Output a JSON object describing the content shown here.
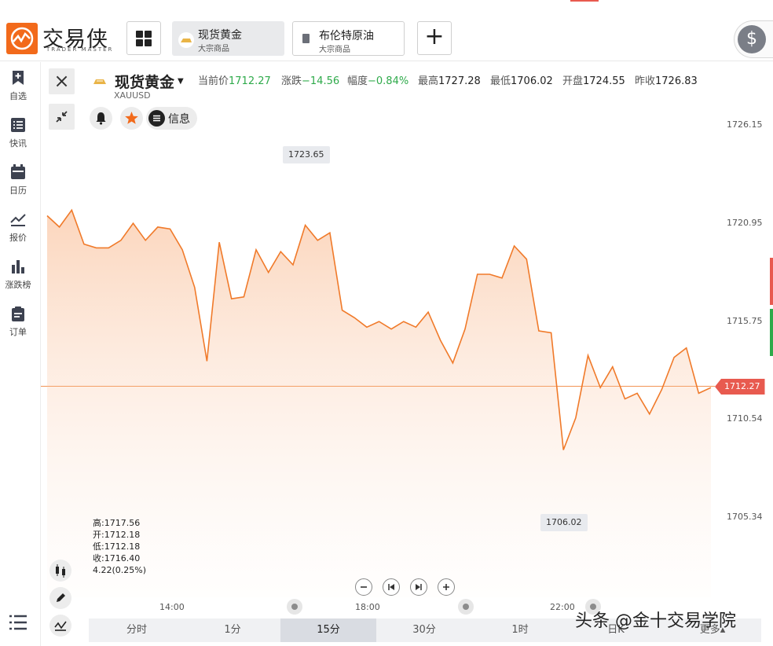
{
  "app": {
    "logo_title": "交易侠",
    "logo_subtitle": "TRADER MASTER"
  },
  "tabs": [
    {
      "name": "现货黄金",
      "sub": "大宗商品",
      "active": true
    },
    {
      "name": "布伦特原油",
      "sub": "大宗商品",
      "active": false
    }
  ],
  "add_tab_label": "+",
  "currency_icon": "$",
  "sidebar": {
    "items": [
      {
        "label": "自选",
        "icon": "bookmark-plus-icon"
      },
      {
        "label": "快讯",
        "icon": "news-list-icon"
      },
      {
        "label": "日历",
        "icon": "calendar-icon"
      },
      {
        "label": "报价",
        "icon": "trend-line-icon"
      },
      {
        "label": "涨跌榜",
        "icon": "bar-chart-icon"
      },
      {
        "label": "订单",
        "icon": "clipboard-icon"
      }
    ]
  },
  "header": {
    "symbol_name": "现货黄金",
    "symbol_code": "XAUUSD",
    "stats": [
      {
        "label": "当前价",
        "value": "1712.27",
        "style": "g"
      },
      {
        "label": "涨跌",
        "value": "−14.56",
        "style": "g"
      },
      {
        "label": "幅度",
        "value": "−0.84%",
        "style": "g"
      },
      {
        "label": "最高",
        "value": "1727.28",
        "style": "v"
      },
      {
        "label": "最低",
        "value": "1706.02",
        "style": "v"
      },
      {
        "label": "开盘",
        "value": "1724.55",
        "style": "v"
      },
      {
        "label": "昨收",
        "value": "1726.83",
        "style": "v"
      }
    ],
    "info_label": "信息",
    "close_icon": "×"
  },
  "chart_data": {
    "type": "area",
    "x_labels": [
      "14:00",
      "18:00",
      "22:00"
    ],
    "price_ticks": [
      "1726.15",
      "1720.95",
      "1715.75",
      "1710.54",
      "1705.34"
    ],
    "ylim": [
      1705.34,
      1726.15
    ],
    "current_price": "1712.27",
    "high_marker": "1723.65",
    "low_marker": "1706.02",
    "line_color": "#f07a2a",
    "values": [
      1721.3,
      1720.7,
      1721.6,
      1719.8,
      1719.6,
      1719.6,
      1720.0,
      1720.9,
      1720.0,
      1720.7,
      1720.6,
      1719.5,
      1717.5,
      1713.6,
      1719.9,
      1716.9,
      1717.0,
      1719.5,
      1718.3,
      1719.4,
      1718.7,
      1720.8,
      1720.0,
      1720.4,
      1716.3,
      1715.9,
      1715.4,
      1715.7,
      1715.3,
      1715.7,
      1715.4,
      1716.2,
      1714.7,
      1713.5,
      1715.3,
      1718.2,
      1718.2,
      1718.0,
      1719.7,
      1719.0,
      1715.2,
      1715.1,
      1708.9,
      1710.6,
      1713.9,
      1712.2,
      1713.3,
      1711.6,
      1711.9,
      1710.8,
      1712.1,
      1713.8,
      1714.3,
      1711.9,
      1712.2
    ]
  },
  "ohlc": {
    "high": "高:1717.56",
    "open": "开:1712.18",
    "low": "低:1712.18",
    "close": "收:1716.40",
    "change": "4.22(0.25%)"
  },
  "periods": [
    {
      "label": "分时",
      "active": false
    },
    {
      "label": "1分",
      "active": false
    },
    {
      "label": "15分",
      "active": true
    },
    {
      "label": "30分",
      "active": false
    },
    {
      "label": "1时",
      "active": false
    },
    {
      "label": "日K",
      "active": false
    },
    {
      "label": "更多▴",
      "active": false
    }
  ],
  "watermark": "头条 @金十交易学院"
}
